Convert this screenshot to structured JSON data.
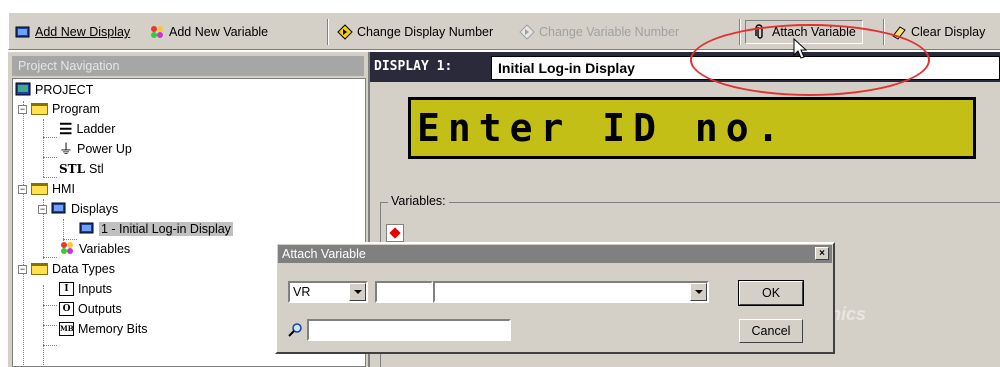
{
  "toolbar": {
    "add_display": "Add New Display",
    "add_variable": "Add New Variable",
    "change_display_number": "Change Display Number",
    "change_variable_number": "Change Variable Number",
    "attach_variable": "Attach Variable",
    "clear_display": "Clear Display"
  },
  "nav": {
    "title": "Project Navigation",
    "root": "PROJECT",
    "program": "Program",
    "ladder": "Ladder",
    "power_up": "Power Up",
    "stl": "Stl",
    "hmi": "HMI",
    "displays": "Displays",
    "display_item": "1 - Initial Log-in Display",
    "variables": "Variables",
    "data_types": "Data Types",
    "inputs": "Inputs",
    "outputs": "Outputs",
    "memory_bits": "Memory Bits"
  },
  "display": {
    "label": "DISPLAY 1:",
    "name": "Initial Log-in Display",
    "lcd_text": "Enter ID no.",
    "variables_label": "Variables:"
  },
  "dialog": {
    "title": "Attach Variable",
    "type_value": "VR",
    "number_value": "",
    "name_value": "",
    "search_value": "",
    "ok_label": "OK",
    "cancel_label": "Cancel"
  },
  "colors": {
    "lcd_background": "#c3bf16",
    "annotation": "#e53030",
    "display_bar": "#2a2a3a"
  }
}
